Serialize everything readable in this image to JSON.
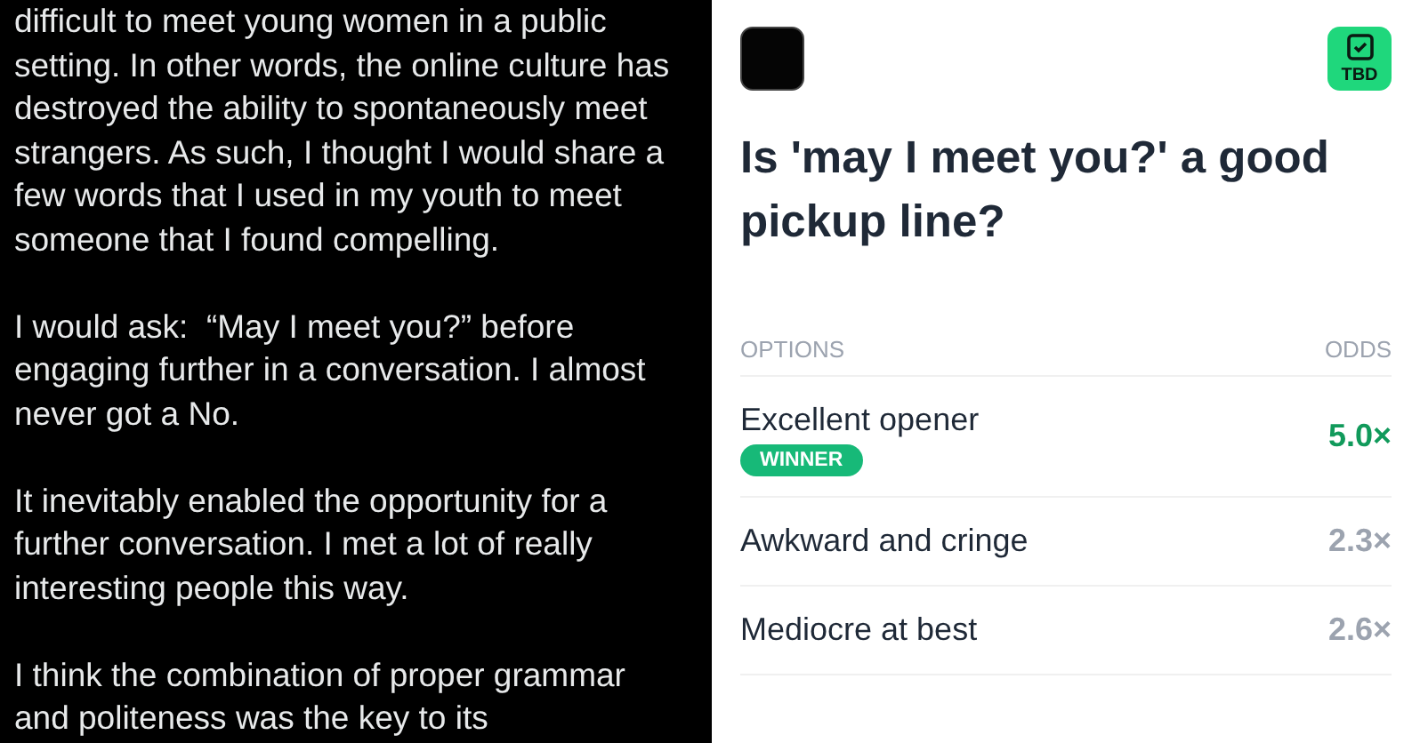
{
  "post": {
    "paragraphs": [
      [
        "difficult to meet young women in a public",
        "setting. In other words, the online culture has",
        "destroyed the ability to spontaneously meet",
        "strangers. As such, I thought I would share a",
        "few words that I used in my youth to meet",
        "someone that I found compelling."
      ],
      [
        "I would ask:  “May I meet you?” before",
        "engaging further in a conversation. I almost",
        "never got a No."
      ],
      [
        "It inevitably enabled the opportunity for a",
        "further conversation. I met a lot of really",
        "interesting people this way."
      ],
      [
        "I think the combination of proper grammar",
        "and politeness was the key to its"
      ]
    ]
  },
  "market": {
    "status_badge": "TBD",
    "question": "Is 'may I meet you?' a good pickup line?",
    "columns": [
      "OPTIONS",
      "ODDS"
    ],
    "winner_label": "WINNER",
    "options": [
      {
        "label": "Excellent opener",
        "odds": "5.0×",
        "winner": true
      },
      {
        "label": "Awkward and cringe",
        "odds": "2.3×",
        "winner": false
      },
      {
        "label": "Mediocre at best",
        "odds": "2.6×",
        "winner": false
      }
    ]
  }
}
